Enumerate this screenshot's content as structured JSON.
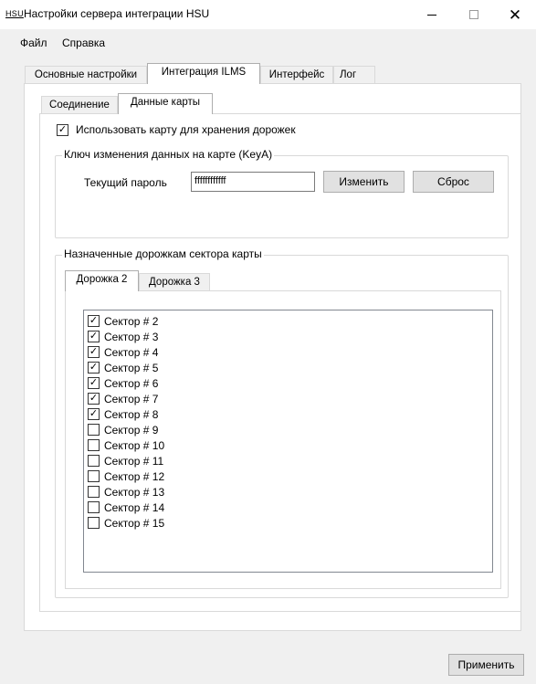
{
  "window": {
    "icon_text": "HSU",
    "title": "Настройки сервера интеграции HSU",
    "minimize_glyph": "—",
    "close_glyph": "✕"
  },
  "menu": {
    "file": "Файл",
    "help": "Справка"
  },
  "outer_tabs": [
    {
      "label": "Основные настройки",
      "active": false
    },
    {
      "label": "Интеграция ILMS",
      "active": true
    },
    {
      "label": "Интерфейс",
      "active": false
    },
    {
      "label": "Лог",
      "active": false
    }
  ],
  "inner_tabs": [
    {
      "label": "Соединение",
      "active": false
    },
    {
      "label": "Данные карты",
      "active": true
    }
  ],
  "use_card": {
    "label": "Использовать карту для хранения дорожек",
    "checked": true
  },
  "key_group": {
    "label": "Ключ изменения данных на карте (KeyA)",
    "password_label": "Текущий пароль",
    "password_value": "ffffffffffff",
    "change_button": "Изменить",
    "reset_button": "Сброс"
  },
  "sectors_group": {
    "label": "Назначенные дорожкам сектора карты",
    "tabs": [
      {
        "label": "Дорожка 2",
        "active": true
      },
      {
        "label": "Дорожка 3",
        "active": false
      }
    ],
    "sectors": [
      {
        "label": "Сектор # 2",
        "checked": true
      },
      {
        "label": "Сектор # 3",
        "checked": true
      },
      {
        "label": "Сектор # 4",
        "checked": true
      },
      {
        "label": "Сектор # 5",
        "checked": true
      },
      {
        "label": "Сектор # 6",
        "checked": true
      },
      {
        "label": "Сектор # 7",
        "checked": true
      },
      {
        "label": "Сектор # 8",
        "checked": true
      },
      {
        "label": "Сектор # 9",
        "checked": false
      },
      {
        "label": "Сектор # 10",
        "checked": false
      },
      {
        "label": "Сектор # 11",
        "checked": false
      },
      {
        "label": "Сектор # 12",
        "checked": false
      },
      {
        "label": "Сектор # 13",
        "checked": false
      },
      {
        "label": "Сектор # 14",
        "checked": false
      },
      {
        "label": "Сектор # 15",
        "checked": false
      }
    ]
  },
  "apply_button": "Применить",
  "check_glyph": "✓"
}
